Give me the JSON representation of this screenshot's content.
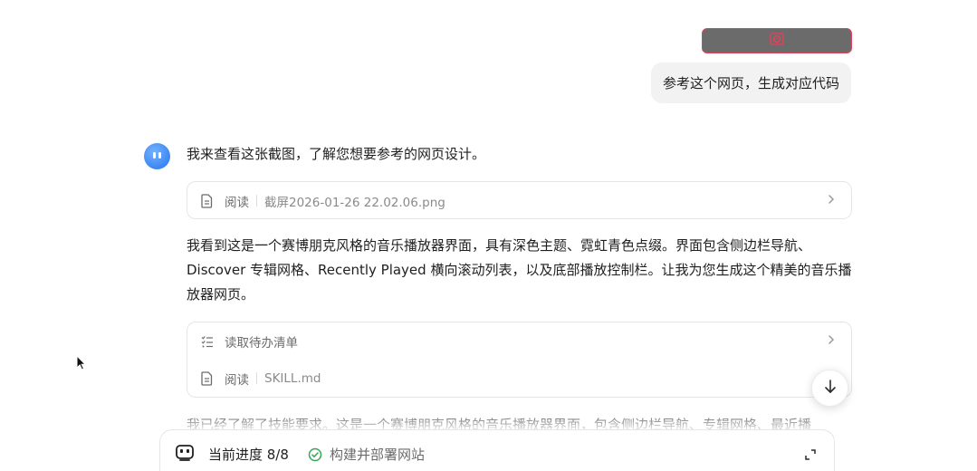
{
  "user_message": {
    "attachment_icon": "image-error-icon",
    "text": "参考这个网页，生成对应代码"
  },
  "assistant": {
    "avatar_icon": "assistant-avatar-icon",
    "intro": "我来查看这张截图，了解您想要参考的网页设计。",
    "tool_read_image": {
      "action": "阅读",
      "target": "截屏2026-01-26 22.02.06.png"
    },
    "analysis": "我看到这是一个赛博朋克风格的音乐播放器界面，具有深色主题、霓虹青色点缀。界面包含侧边栏导航、Discover 专辑网格、Recently Played 横向滚动列表，以及底部播放控制栏。让我为您生成这个精美的音乐播放器网页。",
    "tool_todo": {
      "action": "读取待办清单"
    },
    "tool_read_skill": {
      "action": "阅读",
      "target": "SKILL.md"
    },
    "followup": "我已经了解了技能要求。这是一个赛博朋克风格的音乐播放器界面，包含侧边栏导航、专辑网格、最近播"
  },
  "bottom_bar": {
    "progress_label": "当前进度 8/8",
    "task_label": "构建并部署网站"
  },
  "colors": {
    "accent_blue": "#3d86f2",
    "success_green": "#34a853",
    "error_border": "#e0435a"
  }
}
